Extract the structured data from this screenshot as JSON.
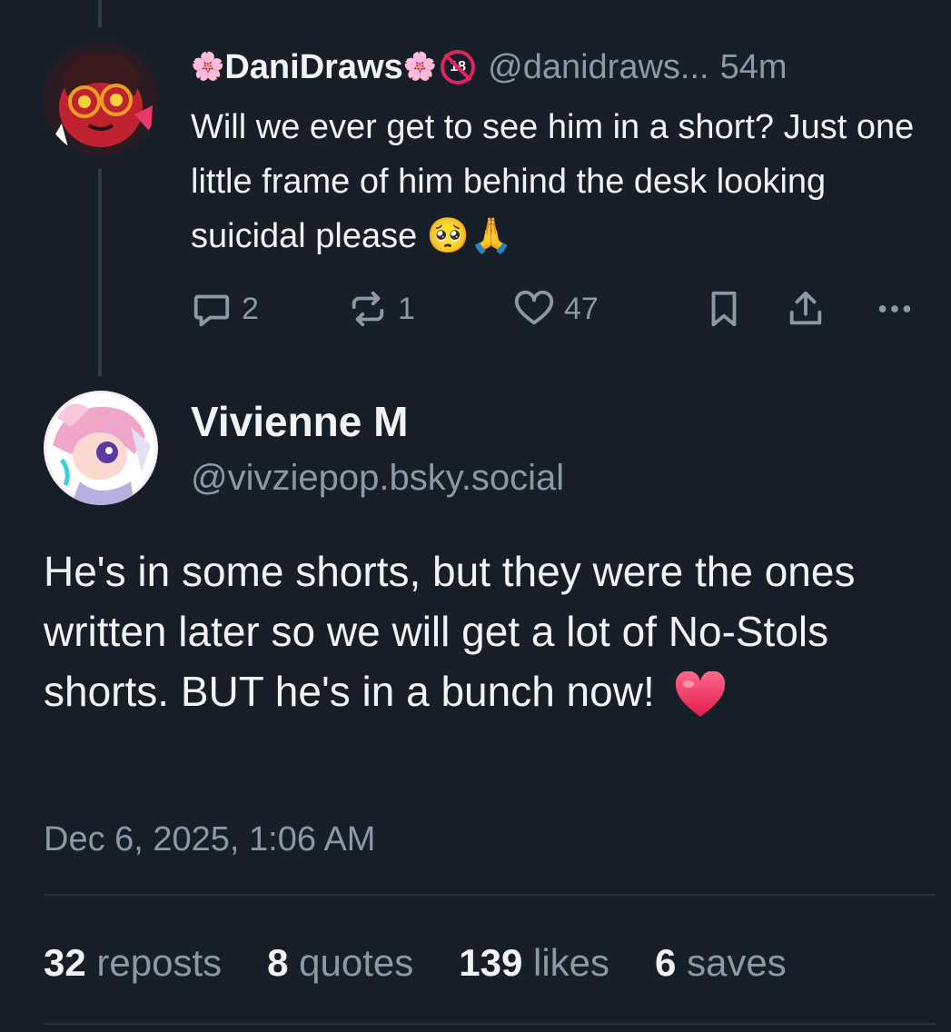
{
  "parent_post": {
    "display_name": "DaniDraws",
    "name_prefix_emoji": "🌸",
    "name_suffix_emoji": "🌸",
    "badge": "18",
    "handle": "@danidraws...",
    "time": "54m",
    "text": "Will we ever get to see him in a short? Just one little frame of him behind the desk looking suicidal please 🥺🙏",
    "actions": {
      "replies": "2",
      "reposts": "1",
      "likes": "47"
    }
  },
  "post": {
    "display_name": "Vivienne M",
    "handle": "@vivziepop.bsky.social",
    "text": "He's in some shorts, but they were the ones written later so we will get a lot of No-Stols shorts. BUT he's in a bunch now!",
    "date": "Dec 6, 2025, 1:06 AM",
    "stats": [
      {
        "count": "32",
        "label": "reposts"
      },
      {
        "count": "8",
        "label": "quotes"
      },
      {
        "count": "139",
        "label": "likes"
      },
      {
        "count": "6",
        "label": "saves"
      }
    ]
  },
  "colors": {
    "background": "#161e27",
    "text": "#f1f3f5",
    "muted": "#8b98a8",
    "heart": "#e8395f"
  },
  "icons": [
    "reply-icon",
    "repost-icon",
    "like-icon",
    "bookmark-icon",
    "share-icon",
    "more-icon",
    "nsfw-18-icon",
    "heart-emoji"
  ]
}
